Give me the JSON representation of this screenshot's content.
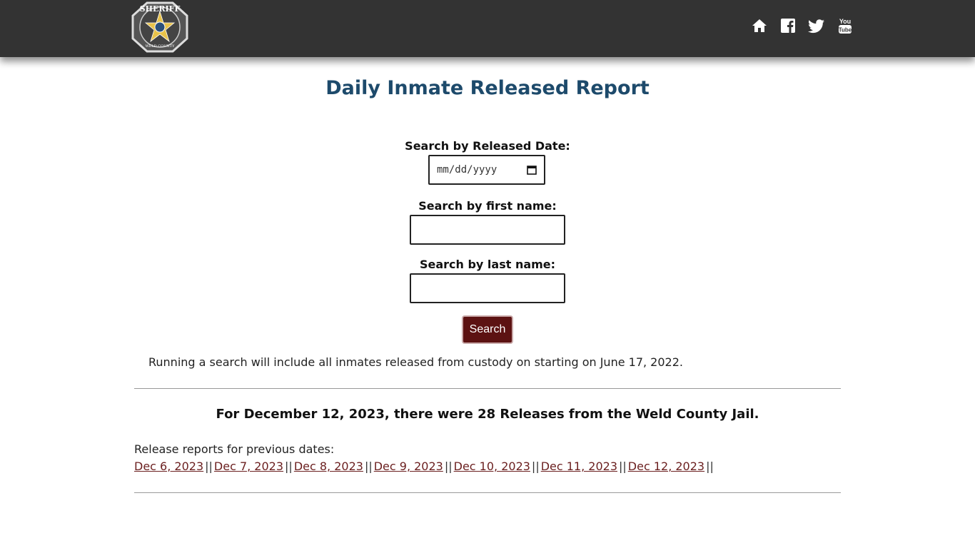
{
  "header": {
    "logo_text": "SHERIFF",
    "logo_subtext": "WELD COUNTY",
    "icons": [
      "home-icon",
      "facebook-icon",
      "twitter-icon",
      "youtube-icon"
    ],
    "background_color": "#333333"
  },
  "page": {
    "title": "Daily Inmate Released Report",
    "title_color": "#1d4a6b"
  },
  "search": {
    "date_label": "Search by Released Date:",
    "date_placeholder": "mm/dd/yyyy",
    "first_name_label": "Search by first name:",
    "first_name_value": "",
    "last_name_label": "Search by last name:",
    "last_name_value": "",
    "button_label": "Search",
    "button_color": "#5c1212",
    "note": "Running a search will include all inmates released from custody on starting on June 17, 2022."
  },
  "summary": {
    "text": "For December 12, 2023, there were 28 Releases from the Weld County Jail."
  },
  "previous": {
    "label": "Release reports for previous dates:",
    "links": [
      "Dec 6, 2023",
      "Dec 7, 2023",
      "Dec 8, 2023",
      "Dec 9, 2023",
      "Dec 10, 2023",
      "Dec 11, 2023",
      "Dec 12, 2023"
    ],
    "separator": "||",
    "link_color": "#6b1f1f"
  }
}
